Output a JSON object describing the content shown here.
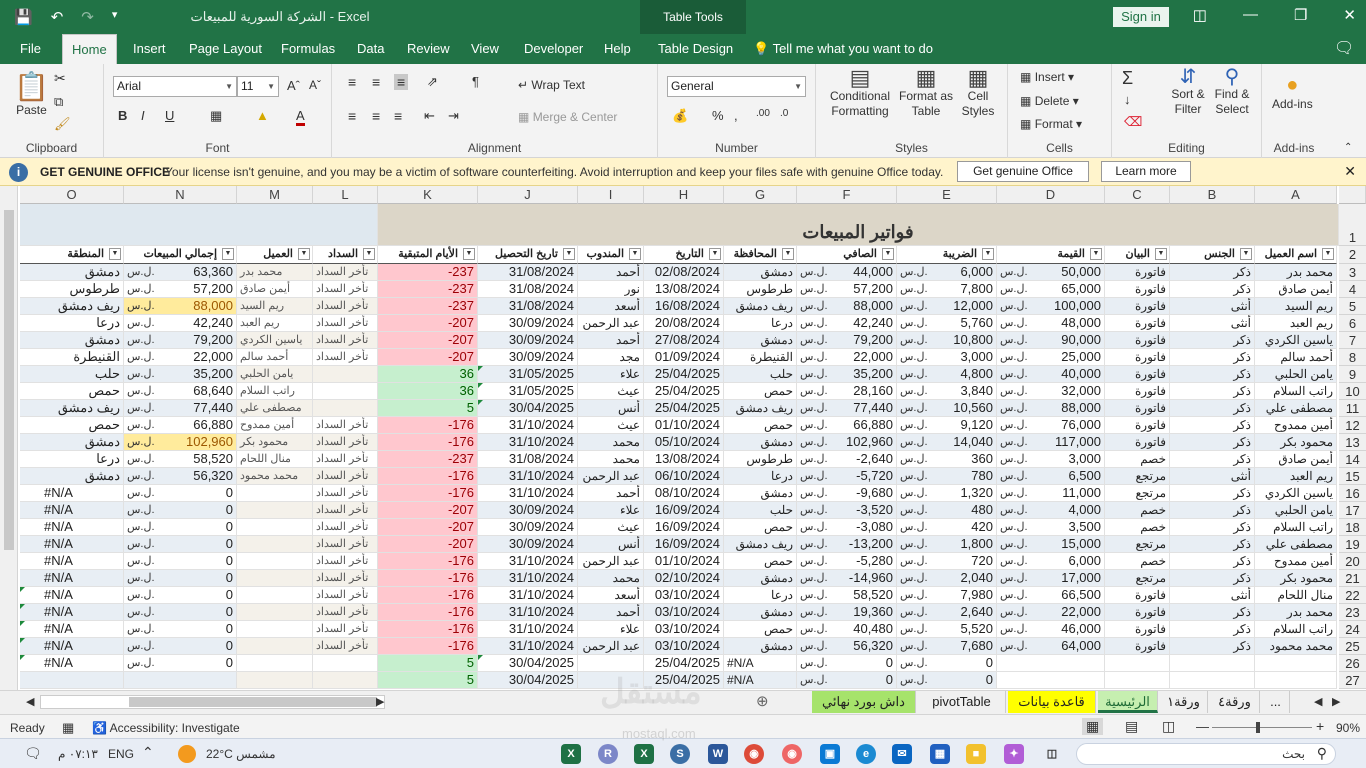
{
  "titlebar": {
    "title": "الشركة السورية للمبيعات  -  Excel",
    "table_tools": "Table Tools",
    "sign_in": "Sign in"
  },
  "tabs": [
    "File",
    "Home",
    "Insert",
    "Page Layout",
    "Formulas",
    "Data",
    "Review",
    "View",
    "Developer",
    "Help",
    "Table Design",
    "Tell me what you want to do"
  ],
  "ribbon": {
    "clipboard": {
      "label": "Clipboard",
      "paste": "Paste"
    },
    "font": {
      "label": "Font",
      "name": "Arial",
      "size": "11"
    },
    "alignment": {
      "label": "Alignment",
      "wrap": "Wrap Text",
      "merge": "Merge & Center"
    },
    "number": {
      "label": "Number",
      "format": "General"
    },
    "styles": {
      "label": "Styles",
      "cond": "Conditional Formatting",
      "format_table": "Format as Table",
      "cell_styles": "Cell Styles"
    },
    "cells": {
      "label": "Cells",
      "insert": "Insert",
      "delete": "Delete",
      "format": "Format"
    },
    "editing": {
      "label": "Editing",
      "sort": "Sort & Filter",
      "find": "Find & Select"
    },
    "addins": {
      "label": "Add-ins",
      "btn": "Add-ins"
    }
  },
  "message": {
    "heading": "GET GENUINE OFFICE",
    "text": "Your license isn't genuine, and you may be a victim of software counterfeiting. Avoid interruption and keep your files safe with genuine Office today.",
    "btn1": "Get genuine Office",
    "btn2": "Learn more"
  },
  "columns": [
    "O",
    "N",
    "M",
    "L",
    "K",
    "J",
    "I",
    "H",
    "G",
    "F",
    "E",
    "D",
    "C",
    "B",
    "A"
  ],
  "sheet_title": "فواتير المبيعات",
  "currency": "ل.س.",
  "headers": [
    "المنطقة",
    "إجمالي المبيعات",
    "العميل",
    "السداد",
    "الأيام المتبقية",
    "تاريخ التحصيل",
    "المندوب",
    "التاريخ",
    "المحافظة",
    "الصافي",
    "الضريبة",
    "القيمة",
    "البيان",
    "الجنس",
    "اسم العميل"
  ],
  "rows": [
    {
      "r": "3",
      "A": "محمد بدر",
      "B": "ذكر",
      "C": "فاتورة",
      "D": "50,000",
      "E": "6,000",
      "F": "44,000",
      "G": "دمشق",
      "H": "02/08/2024",
      "I": "أحمد",
      "J": "31/08/2024",
      "K": "-237",
      "L": "تأخر السداد",
      "M": "محمد بدر",
      "N": "63,360",
      "O": "دمشق"
    },
    {
      "r": "4",
      "A": "أيمن صادق",
      "B": "ذكر",
      "C": "فاتورة",
      "D": "65,000",
      "E": "7,800",
      "F": "57,200",
      "G": "طرطوس",
      "H": "13/08/2024",
      "I": "نور",
      "J": "31/08/2024",
      "K": "-237",
      "L": "تأخر السداد",
      "M": "أيمن صادق",
      "N": "57,200",
      "O": "طرطوس"
    },
    {
      "r": "5",
      "A": "ريم السيد",
      "B": "أنثى",
      "C": "فاتورة",
      "D": "100,000",
      "E": "12,000",
      "F": "88,000",
      "G": "ريف دمشق",
      "H": "16/08/2024",
      "I": "أسعد",
      "J": "31/08/2024",
      "K": "-237",
      "L": "تأخر السداد",
      "M": "ريم السيد",
      "N": "88,000",
      "O": "ريف دمشق"
    },
    {
      "r": "6",
      "A": "ريم العبد",
      "B": "أنثى",
      "C": "فاتورة",
      "D": "48,000",
      "E": "5,760",
      "F": "42,240",
      "G": "درعا",
      "H": "20/08/2024",
      "I": "عبد الرحمن",
      "J": "30/09/2024",
      "K": "-207",
      "L": "تأخر السداد",
      "M": "ريم العبد",
      "N": "42,240",
      "O": "درعا"
    },
    {
      "r": "7",
      "A": "ياسين الكردي",
      "B": "ذكر",
      "C": "فاتورة",
      "D": "90,000",
      "E": "10,800",
      "F": "79,200",
      "G": "دمشق",
      "H": "27/08/2024",
      "I": "أحمد",
      "J": "30/09/2024",
      "K": "-207",
      "L": "تأخر السداد",
      "M": "ياسين الكردي",
      "N": "79,200",
      "O": "دمشق"
    },
    {
      "r": "8",
      "A": "أحمد سالم",
      "B": "ذكر",
      "C": "فاتورة",
      "D": "25,000",
      "E": "3,000",
      "F": "22,000",
      "G": "القنيطرة",
      "H": "01/09/2024",
      "I": "مجد",
      "J": "30/09/2024",
      "K": "-207",
      "L": "تأخر السداد",
      "M": "أحمد سالم",
      "N": "22,000",
      "O": "القنيطرة"
    },
    {
      "r": "9",
      "A": "يامن الحلبي",
      "B": "ذكر",
      "C": "فاتورة",
      "D": "40,000",
      "E": "4,800",
      "F": "35,200",
      "G": "حلب",
      "H": "25/04/2025",
      "I": "علاء",
      "J": "31/05/2025",
      "K": "36",
      "L": "",
      "M": "يامن الحلبي",
      "N": "35,200",
      "O": "حلب"
    },
    {
      "r": "10",
      "A": "راتب السلام",
      "B": "ذكر",
      "C": "فاتورة",
      "D": "32,000",
      "E": "3,840",
      "F": "28,160",
      "G": "حمص",
      "H": "25/04/2025",
      "I": "عيث",
      "J": "31/05/2025",
      "K": "36",
      "L": "",
      "M": "راتب السلام",
      "N": "68,640",
      "O": "حمص"
    },
    {
      "r": "11",
      "A": "مصطفى علي",
      "B": "ذكر",
      "C": "فاتورة",
      "D": "88,000",
      "E": "10,560",
      "F": "77,440",
      "G": "ريف دمشق",
      "H": "25/04/2025",
      "I": "أنس",
      "J": "30/04/2025",
      "K": "5",
      "L": "",
      "M": "مصطفى علي",
      "N": "77,440",
      "O": "ريف دمشق"
    },
    {
      "r": "12",
      "A": "أمين ممدوح",
      "B": "ذكر",
      "C": "فاتورة",
      "D": "76,000",
      "E": "9,120",
      "F": "66,880",
      "G": "حمص",
      "H": "01/10/2024",
      "I": "عيث",
      "J": "31/10/2024",
      "K": "-176",
      "L": "تأخر السداد",
      "M": "أمين ممدوح",
      "N": "66,880",
      "O": "حمص"
    },
    {
      "r": "13",
      "A": "محمود بكر",
      "B": "ذكر",
      "C": "فاتورة",
      "D": "117,000",
      "E": "14,040",
      "F": "102,960",
      "G": "دمشق",
      "H": "05/10/2024",
      "I": "محمد",
      "J": "31/10/2024",
      "K": "-176",
      "L": "تأخر السداد",
      "M": "محمود بكر",
      "N": "102,960",
      "O": "دمشق"
    },
    {
      "r": "14",
      "A": "أيمن صادق",
      "B": "ذكر",
      "C": "خصم",
      "D": "3,000",
      "E": "360",
      "F": "-2,640",
      "G": "طرطوس",
      "H": "13/08/2024",
      "I": "محمد",
      "J": "31/08/2024",
      "K": "-237",
      "L": "تأخر السداد",
      "M": "منال اللحام",
      "N": "58,520",
      "O": "درعا"
    },
    {
      "r": "15",
      "A": "ريم العبد",
      "B": "أنثى",
      "C": "مرتجع",
      "D": "6,500",
      "E": "780",
      "F": "-5,720",
      "G": "درعا",
      "H": "06/10/2024",
      "I": "عبد الرحمن",
      "J": "31/10/2024",
      "K": "-176",
      "L": "تأخر السداد",
      "M": "محمد محمود",
      "N": "56,320",
      "O": "دمشق"
    },
    {
      "r": "16",
      "A": "ياسين الكردي",
      "B": "ذكر",
      "C": "مرتجع",
      "D": "11,000",
      "E": "1,320",
      "F": "-9,680",
      "G": "دمشق",
      "H": "08/10/2024",
      "I": "أحمد",
      "J": "31/10/2024",
      "K": "-176",
      "L": "تأخر السداد",
      "M": "",
      "N": "0",
      "O": "#N/A"
    },
    {
      "r": "17",
      "A": "يامن الحلبي",
      "B": "ذكر",
      "C": "خصم",
      "D": "4,000",
      "E": "480",
      "F": "-3,520",
      "G": "حلب",
      "H": "16/09/2024",
      "I": "علاء",
      "J": "30/09/2024",
      "K": "-207",
      "L": "تأخر السداد",
      "M": "",
      "N": "0",
      "O": "#N/A"
    },
    {
      "r": "18",
      "A": "راتب السلام",
      "B": "ذكر",
      "C": "خصم",
      "D": "3,500",
      "E": "420",
      "F": "-3,080",
      "G": "حمص",
      "H": "16/09/2024",
      "I": "عيث",
      "J": "30/09/2024",
      "K": "-207",
      "L": "تأخر السداد",
      "M": "",
      "N": "0",
      "O": "#N/A"
    },
    {
      "r": "19",
      "A": "مصطفى علي",
      "B": "ذكر",
      "C": "مرتجع",
      "D": "15,000",
      "E": "1,800",
      "F": "-13,200",
      "G": "ريف دمشق",
      "H": "16/09/2024",
      "I": "أنس",
      "J": "30/09/2024",
      "K": "-207",
      "L": "تأخر السداد",
      "M": "",
      "N": "0",
      "O": "#N/A"
    },
    {
      "r": "20",
      "A": "أمين ممدوح",
      "B": "ذكر",
      "C": "خصم",
      "D": "6,000",
      "E": "720",
      "F": "-5,280",
      "G": "حمص",
      "H": "01/10/2024",
      "I": "عبد الرحمن",
      "J": "31/10/2024",
      "K": "-176",
      "L": "تأخر السداد",
      "M": "",
      "N": "0",
      "O": "#N/A"
    },
    {
      "r": "21",
      "A": "محمود بكر",
      "B": "ذكر",
      "C": "مرتجع",
      "D": "17,000",
      "E": "2,040",
      "F": "-14,960",
      "G": "دمشق",
      "H": "02/10/2024",
      "I": "محمد",
      "J": "31/10/2024",
      "K": "-176",
      "L": "تأخر السداد",
      "M": "",
      "N": "0",
      "O": "#N/A"
    },
    {
      "r": "22",
      "A": "منال اللحام",
      "B": "أنثى",
      "C": "فاتورة",
      "D": "66,500",
      "E": "7,980",
      "F": "58,520",
      "G": "درعا",
      "H": "03/10/2024",
      "I": "أسعد",
      "J": "31/10/2024",
      "K": "-176",
      "L": "تأخر السداد",
      "M": "",
      "N": "0",
      "O": "#N/A"
    },
    {
      "r": "23",
      "A": "محمد بدر",
      "B": "ذكر",
      "C": "فاتورة",
      "D": "22,000",
      "E": "2,640",
      "F": "19,360",
      "G": "دمشق",
      "H": "03/10/2024",
      "I": "أحمد",
      "J": "31/10/2024",
      "K": "-176",
      "L": "تأخر السداد",
      "M": "",
      "N": "0",
      "O": "#N/A"
    },
    {
      "r": "24",
      "A": "راتب السلام",
      "B": "ذكر",
      "C": "فاتورة",
      "D": "46,000",
      "E": "5,520",
      "F": "40,480",
      "G": "حمص",
      "H": "03/10/2024",
      "I": "علاء",
      "J": "31/10/2024",
      "K": "-176",
      "L": "تأخر السداد",
      "M": "",
      "N": "0",
      "O": "#N/A"
    },
    {
      "r": "25",
      "A": "محمد محمود",
      "B": "ذكر",
      "C": "فاتورة",
      "D": "64,000",
      "E": "7,680",
      "F": "56,320",
      "G": "دمشق",
      "H": "03/10/2024",
      "I": "عبد الرحمن",
      "J": "31/10/2024",
      "K": "-176",
      "L": "تأخر السداد",
      "M": "",
      "N": "0",
      "O": "#N/A"
    },
    {
      "r": "26",
      "A": "",
      "B": "",
      "C": "",
      "D": "",
      "E": "0",
      "F": "0",
      "G": "#N/A",
      "H": "25/04/2025",
      "I": "",
      "J": "30/04/2025",
      "K": "5",
      "L": "",
      "M": "",
      "N": "0",
      "O": "#N/A"
    },
    {
      "r": "27",
      "A": "",
      "B": "",
      "C": "",
      "D": "",
      "E": "0",
      "F": "0",
      "G": "#N/A",
      "H": "25/04/2025",
      "I": "",
      "J": "30/04/2025",
      "K": "5",
      "L": "",
      "M": "",
      "N": "",
      "O": ""
    }
  ],
  "sheet_tabs": [
    "...",
    "الرئيسية",
    "قاعدة بيانات",
    "pivotTable",
    "داش بورد نهائي",
    "ورقة١",
    "ورقة٤"
  ],
  "status": {
    "ready": "Ready",
    "accessibility": "Accessibility: Investigate",
    "zoom": "90%"
  },
  "taskbar": {
    "search": "بحث",
    "weather": "22°C  مشمس",
    "lang": "ENG",
    "time": "٠٧:١٣ م"
  },
  "watermark": {
    "main": "مستقل",
    "sub": "mostaql.com"
  }
}
